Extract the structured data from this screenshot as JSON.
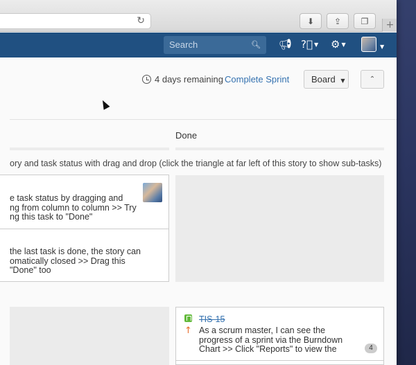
{
  "colors": {
    "header_bg": "#205081",
    "link": "#3572b0",
    "story_green": "#63ba3c",
    "priority_orange": "#e86b2a"
  },
  "header": {
    "search_placeholder": "Search",
    "icons": [
      "megaphone-icon",
      "help-icon",
      "gear-icon",
      "avatar"
    ]
  },
  "sprint": {
    "remaining": "4 days remaining",
    "complete_label": "Complete Sprint",
    "board_label": "Board"
  },
  "columns": {
    "done_label": "Done"
  },
  "swimlane": {
    "text": "ory and task status with drag and drop (click the triangle at far left of this story to show sub-tasks)"
  },
  "cards": {
    "task1": "e task status by dragging and\nng from column to column >> Try\nng this task to \"Done\"",
    "task2": "the last task is done, the story can\nomatically closed >> Drag this\n\"Done\" too",
    "done_card": {
      "key": "TIS-15",
      "summary": "As a scrum master, I can see the\nprogress of a sprint via the Burndown\nChart >> Click \"Reports\" to view the",
      "badge": "4"
    }
  }
}
